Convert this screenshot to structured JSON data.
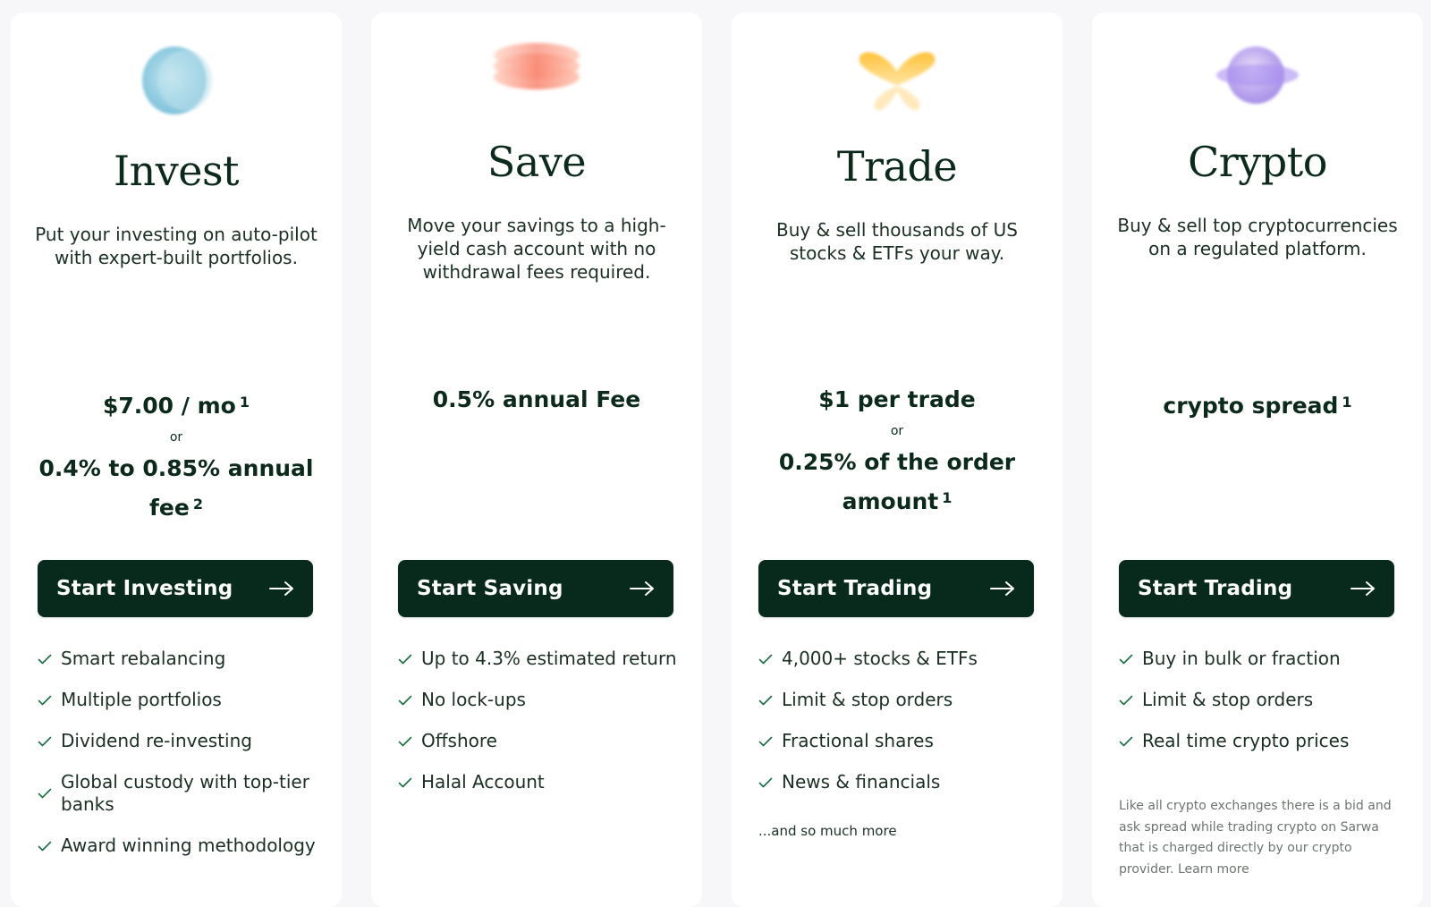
{
  "colors": {
    "page_background": "#f7f6f9",
    "card_background": "#ffffff",
    "primary_dark_green": "#082a1c",
    "check_green": "#1c6e43",
    "note_gray": "#6e7470"
  },
  "cards": [
    {
      "icon": "blue-orb-icon",
      "title": "Invest",
      "description": "Put your investing on auto-pilot with expert-built portfolios.",
      "price_main": "$7.00 / mo",
      "price_main_sup": "1",
      "price_or": "or",
      "price_alt": "0.4% to 0.85% annual fee",
      "price_alt_sup": "2",
      "cta_label": "Start Investing",
      "features": [
        "Smart rebalancing",
        "Multiple portfolios",
        "Dividend re-investing",
        "Global custody with top-tier banks",
        "Award winning methodology"
      ]
    },
    {
      "icon": "coral-stack-icon",
      "title": "Save",
      "description": "Move your savings to a high-yield cash account with no withdrawal fees required.",
      "price_main": "0.5% annual Fee",
      "cta_label": "Start Saving",
      "features": [
        "Up to 4.3% estimated return",
        "No lock-ups",
        "Offshore",
        "Halal Account"
      ]
    },
    {
      "icon": "yellow-butterfly-icon",
      "title": "Trade",
      "description": "Buy & sell thousands of US stocks & ETFs your way.",
      "price_main": "$1 per trade",
      "price_or": "or",
      "price_alt": "0.25% of the order amount",
      "price_alt_sup": "1",
      "cta_label": "Start Trading",
      "features": [
        "4,000+ stocks & ETFs",
        "Limit & stop orders",
        "Fractional shares",
        "News & financials"
      ],
      "more_text": "...and so much more"
    },
    {
      "icon": "purple-planet-icon",
      "title": "Crypto",
      "description": "Buy & sell top cryptocurrencies on a regulated platform.",
      "price_main": "crypto spread",
      "price_main_sup": "1",
      "cta_label": "Start Trading",
      "features": [
        "Buy in bulk or fraction",
        "Limit & stop orders",
        "Real time crypto prices"
      ],
      "note_text": "Like all crypto exchanges there is a bid and ask spread while trading crypto on Sarwa that is charged directly by our crypto provider.",
      "note_link": "Learn more"
    }
  ]
}
